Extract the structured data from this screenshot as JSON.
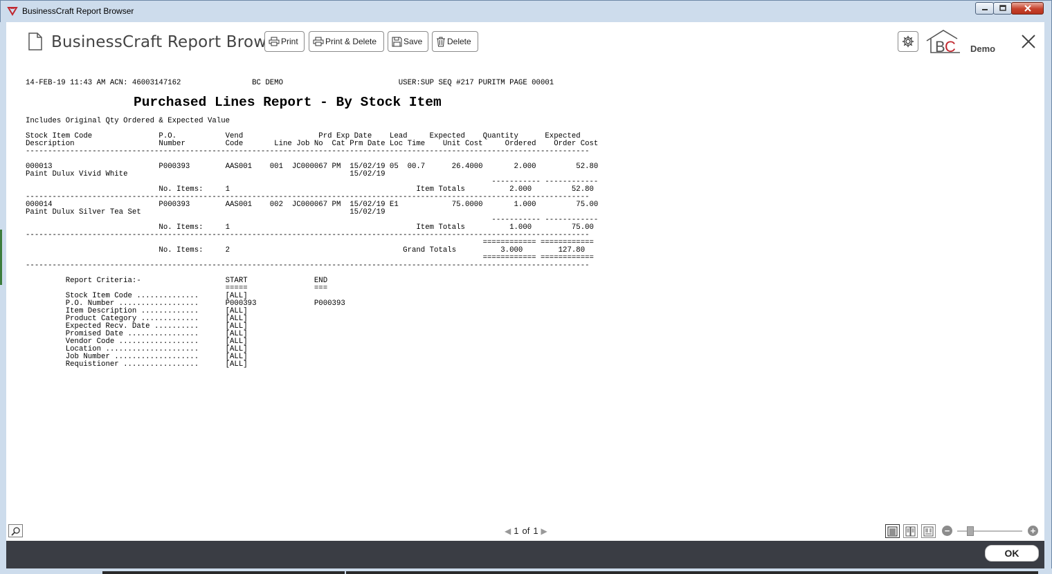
{
  "window": {
    "title": "BusinessCraft Report Browser"
  },
  "header": {
    "app_title": "BusinessCraft Report Browser",
    "buttons": {
      "print": "Print",
      "print_delete": "Print & Delete",
      "save": "Save",
      "delete": "Delete"
    },
    "logo_text": "BC",
    "company": "Demo"
  },
  "report": {
    "text_top": "14-FEB-19 11:43 AM ACN: 46003147162                BC DEMO                          USER:SUP SEQ #217 PURITM PAGE 00001\n\n\n\n\nIncludes Original Qty Ordered & Expected Value\n\nStock Item Code               P.O.           Vend                 Prd Exp Date    Lead     Expected    Quantity      Expected\nDescription                   Number         Code       Line Job No  Cat Prm Date Loc Time    Unit Cost     Ordered    Order Cost\n-------------------------------------------------------------------------------------------------------------------------------\n\n000013                        P000393        AAS001    001  JC000067 PM  15/02/19 05  00.7      26.4000       2.000         52.80\nPaint Dulux Vivid White                                                  15/02/19\n                                                                                                         ----------- ------------\n                              No. Items:     1                                          Item Totals          2.000         52.80\n-------------------------------------------------------------------------------------------------------------------------------\n000014                        P000393        AAS001    002  JC000067 PM  15/02/19 E1            75.0000       1.000         75.00\nPaint Dulux Silver Tea Set                                               15/02/19\n                                                                                                         ----------- ------------\n                              No. Items:     1                                          Item Totals          1.000         75.00\n-------------------------------------------------------------------------------------------------------------------------------\n                                                                                                       ============ ============\n                              No. Items:     2                                       Grand Totals          3.000        127.80\n                                                                                                       ============ ============\n-------------------------------------------------------------------------------------------------------------------------------\n\n         Report Criteria:-                   START               END\n                                             =====               ===\n         Stock Item Code ..............      [ALL]\n         P.O. Number ..................      P000393             P000393\n         Item Description .............      [ALL]\n         Product Category .............      [ALL]\n         Expected Recv. Date ..........      [ALL]\n         Promised Date ................      [ALL]\n         Vendor Code ..................      [ALL]\n         Location .....................      [ALL]\n         Job Number ...................      [ALL]\n         Requistioner .................      [ALL]",
    "title": "Purchased Lines Report - By Stock Item"
  },
  "pager": {
    "current": "1",
    "of_label": "of",
    "total": "1"
  },
  "footer": {
    "ok_label": "OK"
  }
}
